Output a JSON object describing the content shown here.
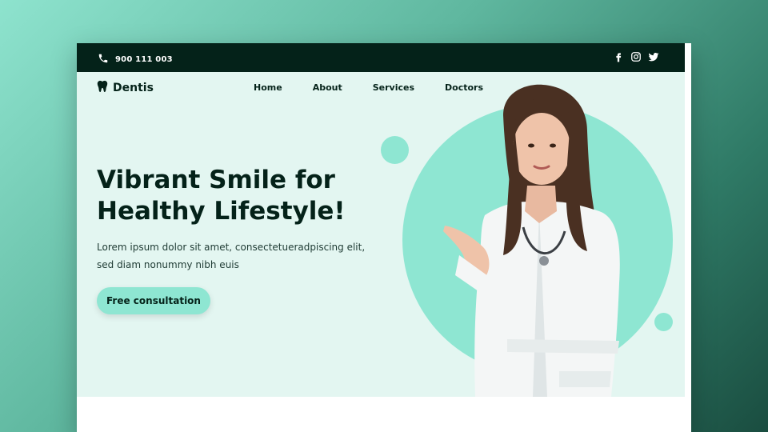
{
  "topbar": {
    "phone": "900 111 003",
    "phone_icon": "phone-icon",
    "socials": [
      "facebook-icon",
      "instagram-icon",
      "twitter-icon"
    ]
  },
  "nav": {
    "logo_text": "Dentis",
    "logo_icon": "tooth-icon",
    "items": [
      {
        "label": "Home"
      },
      {
        "label": "About"
      },
      {
        "label": "Services"
      },
      {
        "label": "Doctors"
      }
    ]
  },
  "hero": {
    "title": "Vibrant Smile for Healthy Lifestyle!",
    "text": "Lorem ipsum dolor sit amet, consectetueradpiscing elit, sed diam nonummy nibh euis",
    "cta_label": "Free consultation"
  },
  "colors": {
    "dark": "#042219",
    "mint": "#8ee6d2",
    "background": "#e3f6f1"
  }
}
